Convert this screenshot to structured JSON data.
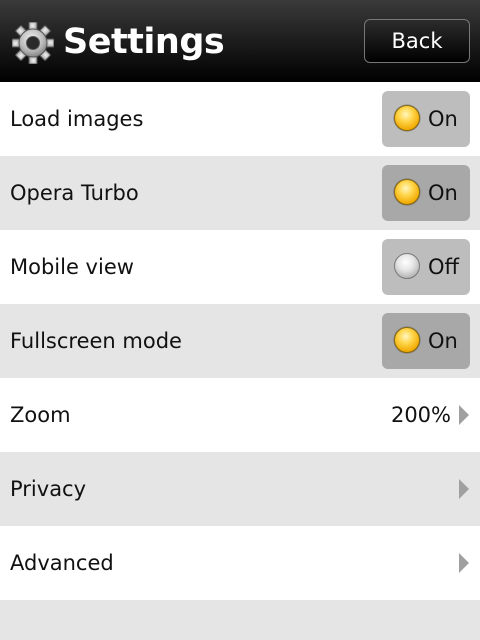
{
  "header": {
    "title": "Settings",
    "icon": "gear-icon",
    "back_label": "Back"
  },
  "settings": {
    "load_images": {
      "label": "Load images",
      "state": "On"
    },
    "opera_turbo": {
      "label": "Opera Turbo",
      "state": "On"
    },
    "mobile_view": {
      "label": "Mobile view",
      "state": "Off"
    },
    "fullscreen_mode": {
      "label": "Fullscreen mode",
      "state": "On"
    },
    "zoom": {
      "label": "Zoom",
      "value": "200%"
    },
    "privacy": {
      "label": "Privacy"
    },
    "advanced": {
      "label": "Advanced"
    }
  },
  "colors": {
    "toggle_on": "#ffc933",
    "toggle_off": "#d0d0d0",
    "header_bg": "#1a1a1a",
    "row_alt_bg": "#e5e5e5"
  }
}
